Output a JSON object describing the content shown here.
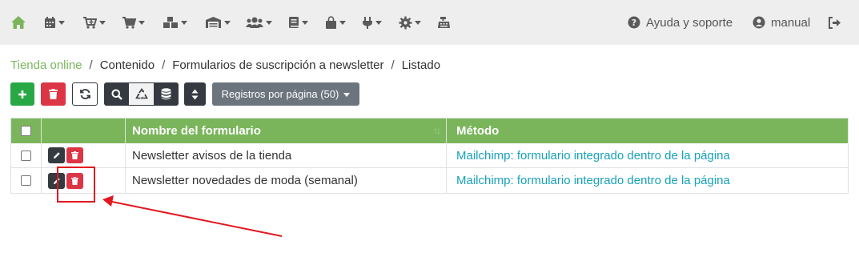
{
  "nav": {
    "help_label": "Ayuda y soporte",
    "user_label": "manual",
    "icons": [
      "home-icon",
      "calendar-icon",
      "cart-plus-icon",
      "cart-icon",
      "boxes-icon",
      "warehouse-icon",
      "users-icon",
      "book-icon",
      "shopping-bag-icon",
      "plug-icon",
      "gear-icon",
      "cash-register-icon",
      "question-circle-icon",
      "user-circle-icon",
      "sign-out-icon"
    ]
  },
  "breadcrumb": {
    "home": "Tienda online",
    "items": [
      "Contenido",
      "Formularios de suscripción a newsletter",
      "Listado"
    ],
    "separator": "/"
  },
  "toolbar": {
    "records_per_page_label": "Registros por página (50)"
  },
  "table": {
    "columns": {
      "name": "Nombre del formulario",
      "method": "Método"
    },
    "rows": [
      {
        "name": "Newsletter avisos de la tienda",
        "method": "Mailchimp: formulario integrado dentro de la página"
      },
      {
        "name": "Newsletter novedades de moda (semanal)",
        "method": "Mailchimp: formulario integrado dentro de la página"
      }
    ]
  },
  "colors": {
    "accent_green": "#7ab55c",
    "success": "#28a745",
    "danger": "#dc3545",
    "dark": "#343a40",
    "link": "#17a2b8",
    "annotation_red": "#e3181f"
  }
}
